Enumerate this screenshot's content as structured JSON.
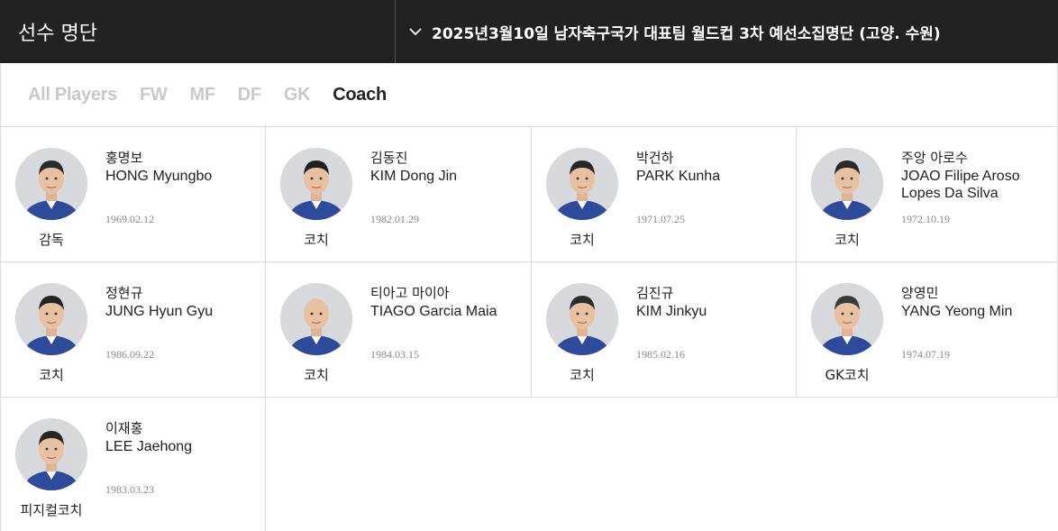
{
  "header": {
    "title": "선수 명단",
    "selected_roster": "2025년3월10일 남자축구국가 대표팀 월드컵 3차 예선소집명단 (고양. 수원)"
  },
  "tabs": [
    "All Players",
    "FW",
    "MF",
    "DF",
    "GK",
    "Coach"
  ],
  "active_tab": "Coach",
  "colors": {
    "header_bg": "#222222",
    "active_tab": "#222222",
    "inactive_tab": "#c9c9c9",
    "border": "#dddddd",
    "birth_text": "#888888",
    "uniform": "#2e4a9a"
  },
  "coaches": [
    {
      "kname": "홍명보",
      "ename": "HONG Myungbo",
      "birth": "1969.02.12",
      "role": "감독"
    },
    {
      "kname": "김동진",
      "ename": "KIM Dong Jin",
      "birth": "1982.01.29",
      "role": "코치"
    },
    {
      "kname": "박건하",
      "ename": "PARK Kunha",
      "birth": "1971.07.25",
      "role": "코치"
    },
    {
      "kname": "주앙 아로수",
      "ename": "JOAO Filipe Aroso Lopes Da Silva",
      "birth": "1972.10.19",
      "role": "코치"
    },
    {
      "kname": "정현규",
      "ename": "JUNG Hyun Gyu",
      "birth": "1986.09.22",
      "role": "코치"
    },
    {
      "kname": "티아고 마이아",
      "ename": "TIAGO Garcia Maia",
      "birth": "1984.03.15",
      "role": "코치"
    },
    {
      "kname": "김진규",
      "ename": "KIM Jinkyu",
      "birth": "1985.02.16",
      "role": "코치"
    },
    {
      "kname": "양영민",
      "ename": "YANG Yeong Min",
      "birth": "1974.07.19",
      "role": "GK코치"
    },
    {
      "kname": "이재홍",
      "ename": "LEE Jaehong",
      "birth": "1983.03.23",
      "role": "피지컬코치"
    }
  ]
}
